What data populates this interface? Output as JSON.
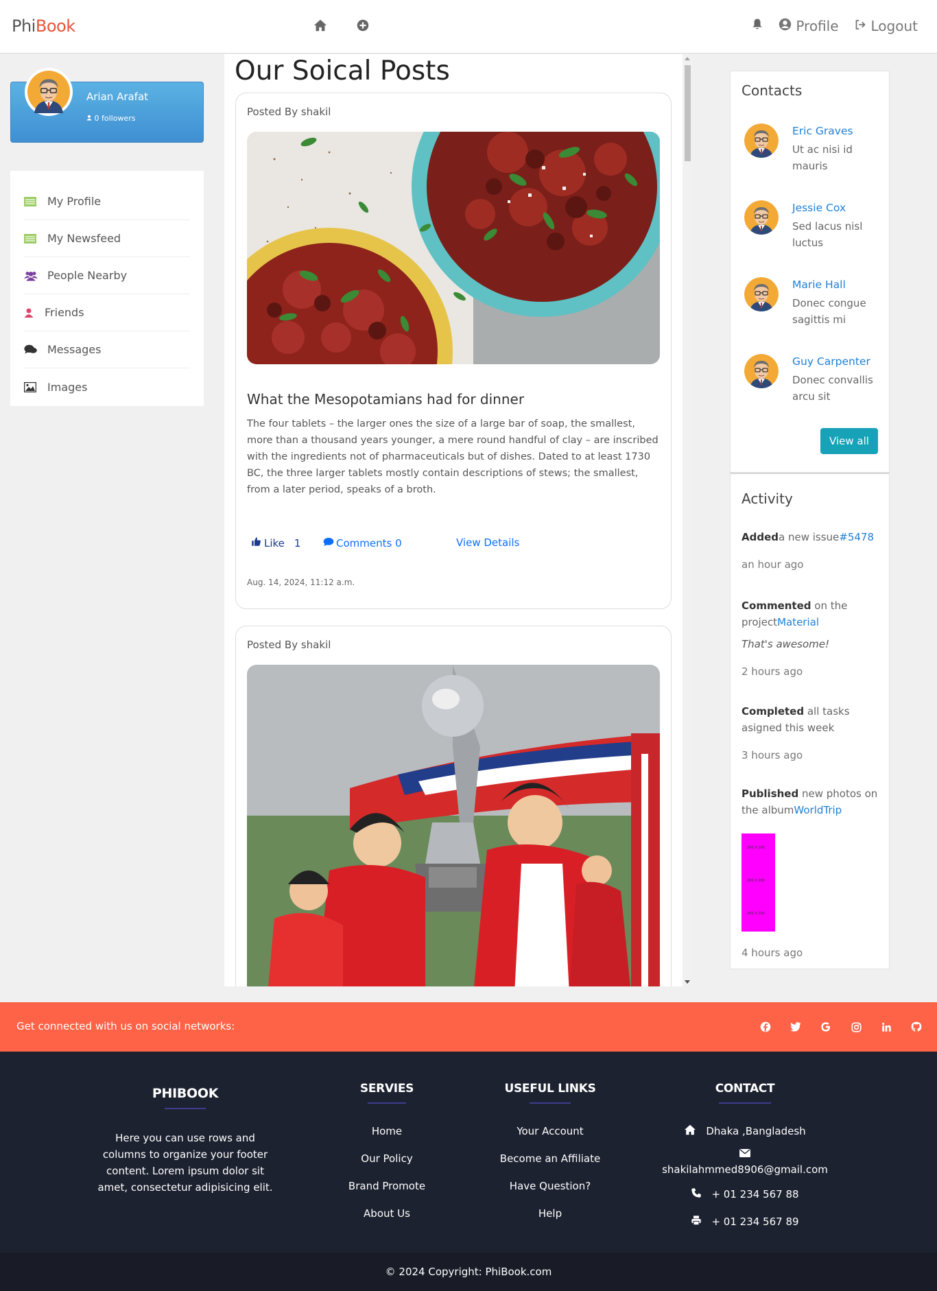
{
  "navbar": {
    "brand_phi": "Phi",
    "brand_book": "Book",
    "profile_label": "Profile",
    "logout_label": "Logout"
  },
  "profile": {
    "name": "Arian Arafat",
    "followers": "0 followers"
  },
  "sidebar": {
    "items": [
      {
        "label": "My Profile",
        "icon": "list-icon"
      },
      {
        "label": "My Newsfeed",
        "icon": "list-icon"
      },
      {
        "label": "People Nearby",
        "icon": "users-icon"
      },
      {
        "label": "Friends",
        "icon": "user-icon"
      },
      {
        "label": "Messages",
        "icon": "comments-icon"
      },
      {
        "label": "Images",
        "icon": "image-icon"
      }
    ]
  },
  "feed": {
    "title": "Our Soical Posts",
    "posts": [
      {
        "author": "Posted By shakil",
        "heading": "What the Mesopotamians had for dinner",
        "body": "The four tablets – the larger ones the size of a large bar of soap, the smallest, more than a thousand years younger, a mere round handful of clay – are inscribed with the ingredients not of pharmaceuticals but of dishes. Dated to at least 1730 BC, the three larger tablets mostly contain descriptions of stews; the smallest, from a later period, speaks of a broth.",
        "like_label": "Like",
        "like_count": "1",
        "comments_label": "Comments 0",
        "details_label": "View Details",
        "date": "Aug. 14, 2024, 11:12 a.m."
      },
      {
        "author": "Posted By shakil"
      }
    ]
  },
  "contacts": {
    "title": "Contacts",
    "items": [
      {
        "name": "Eric Graves",
        "desc": "Ut ac nisi id mauris"
      },
      {
        "name": "Jessie Cox",
        "desc": "Sed lacus nisl luctus"
      },
      {
        "name": "Marie Hall",
        "desc": "Donec congue sagittis mi"
      },
      {
        "name": "Guy Carpenter",
        "desc": "Donec convallis arcu sit"
      }
    ],
    "view_all": "View all"
  },
  "activity": {
    "title": "Activity",
    "items": [
      {
        "strong": "Added",
        "text": "a new issue",
        "link": "#5478",
        "time": "an hour ago"
      },
      {
        "strong": "Commented",
        "text": " on the project",
        "link": "Material",
        "quote": "That's awesome!",
        "time": "2 hours ago"
      },
      {
        "strong": "Completed",
        "text": " all tasks asigned this week",
        "time": "3 hours ago"
      },
      {
        "strong": "Published",
        "text": " new photos on the album",
        "link": "WorldTrip",
        "time": "4 hours ago"
      }
    ],
    "placeholder_text": [
      "200 X 200",
      "200 X 200",
      "200 X 200"
    ]
  },
  "social_bar": {
    "text": "Get connected with us on social networks:",
    "icons": [
      "facebook-icon",
      "twitter-icon",
      "google-icon",
      "instagram-icon",
      "linkedin-icon",
      "github-icon"
    ]
  },
  "footer": {
    "brand": {
      "title": "PHIBOOK",
      "desc": "Here you can use rows and columns to organize your footer content. Lorem ipsum dolor sit amet, consectetur adipisicing elit."
    },
    "services": {
      "title": "SERVIES",
      "links": [
        "Home",
        "Our Policy",
        "Brand Promote",
        "About Us"
      ]
    },
    "useful": {
      "title": "USEFUL LINKS",
      "links": [
        "Your Account",
        "Become an Affiliate",
        "Have Question?",
        "Help"
      ]
    },
    "contact": {
      "title": "CONTACT",
      "address": "Dhaka ,Bangladesh",
      "email": "shakilahmmed8906@gmail.com",
      "phone": "+ 01 234 567 88",
      "fax": "+ 01 234 567 89"
    },
    "copyright": "© 2024 Copyright: PhiBook.com"
  },
  "colors": {
    "brand_accent": "#e8533a",
    "social_bar": "#fe6347",
    "footer_bg": "#1d2230",
    "link": "#1e7fd6",
    "button_teal": "#17a2b8"
  }
}
